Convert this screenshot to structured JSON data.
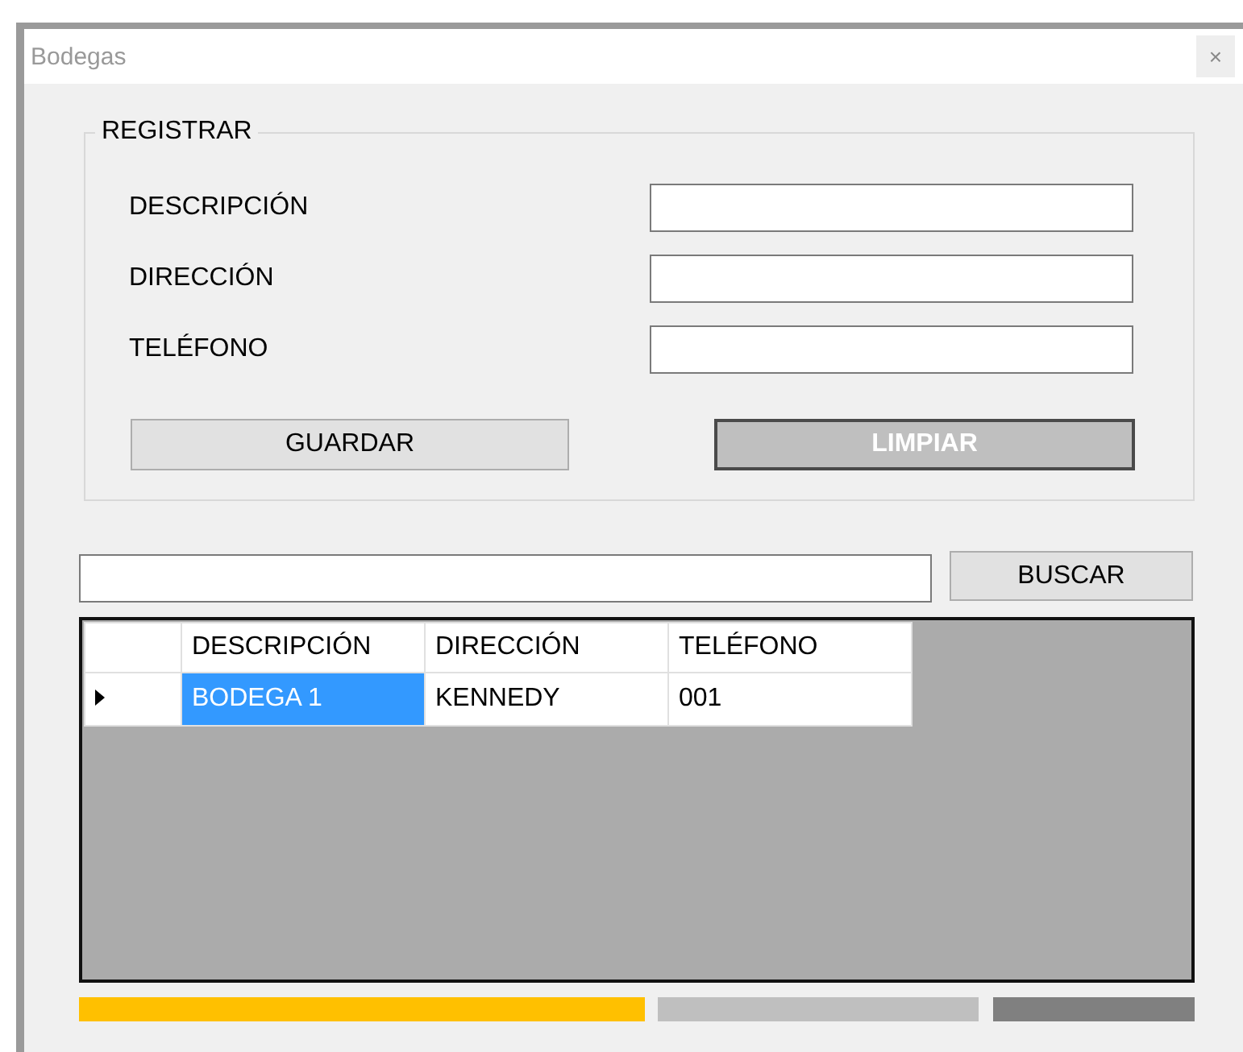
{
  "window": {
    "title": "Bodegas",
    "close": "×"
  },
  "register": {
    "title": "REGISTRAR",
    "fields": [
      {
        "label": "DESCRIPCIÓN"
      },
      {
        "label": "DIRECCIÓN"
      },
      {
        "label": "TELÉFONO"
      }
    ],
    "buttons": [
      {
        "label": "GUARDAR",
        "kind": "flat"
      },
      {
        "label": "LIMPIAR",
        "kind": "dark"
      }
    ]
  },
  "search": {
    "button": "BUSCAR"
  },
  "table": {
    "columns": [
      "DESCRIPCIÓN",
      "DIRECCIÓN",
      "TELÉFONO"
    ],
    "rows": [
      {
        "current": true,
        "cells": [
          {
            "text": "BODEGA 1",
            "selected": true
          },
          {
            "text": "KENNEDY",
            "selected": false
          },
          {
            "text": "001",
            "selected": false
          }
        ]
      }
    ]
  },
  "bars": [
    {
      "color": "#ffc000"
    },
    {
      "color": "#bfbfbf"
    },
    {
      "color": "#808080"
    }
  ]
}
